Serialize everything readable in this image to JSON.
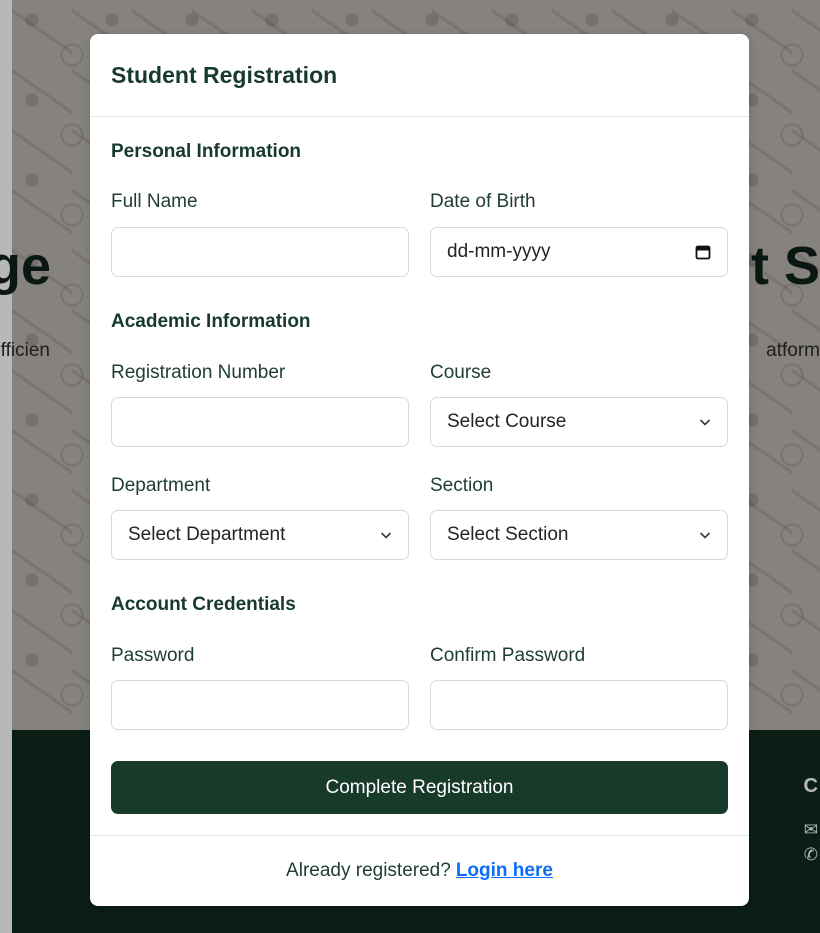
{
  "background": {
    "hero_title_left": "ge",
    "hero_title_right": "t S",
    "hero_sub_left": "Efficien",
    "hero_sub_right": "atform"
  },
  "modal": {
    "title": "Student Registration",
    "sections": {
      "personal": "Personal Information",
      "academic": "Academic Information",
      "account": "Account Credentials"
    },
    "fields": {
      "full_name": {
        "label": "Full Name",
        "value": ""
      },
      "dob": {
        "label": "Date of Birth",
        "placeholder": "dd-mm-yyyy"
      },
      "reg_number": {
        "label": "Registration Number",
        "value": ""
      },
      "course": {
        "label": "Course",
        "selected": "Select Course"
      },
      "department": {
        "label": "Department",
        "selected": "Select Department"
      },
      "section": {
        "label": "Section",
        "selected": "Select Section"
      },
      "password": {
        "label": "Password",
        "value": ""
      },
      "confirm_password": {
        "label": "Confirm Password",
        "value": ""
      }
    },
    "submit_label": "Complete Registration",
    "footer": {
      "prompt": "Already registered?",
      "link": "Login here"
    }
  },
  "colors": {
    "primary": "#173a2b",
    "link": "#0d6efd",
    "footer_bg": "#0f2a1e"
  },
  "icons": {
    "calendar": "calendar-icon",
    "chevron": "chevron-down-icon"
  }
}
